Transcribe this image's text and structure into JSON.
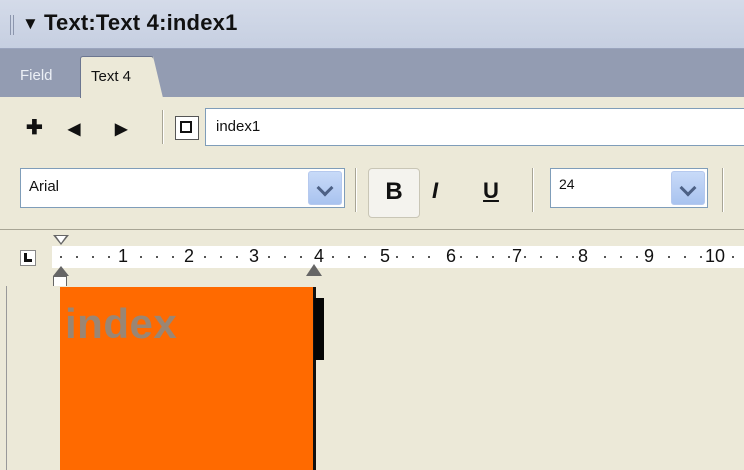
{
  "panel": {
    "title": "Text:Text 4:index1"
  },
  "tabs": [
    {
      "label": "Field"
    },
    {
      "label": "Text 4"
    }
  ],
  "toolbar": {
    "member_name": "index1"
  },
  "format": {
    "font": "Arial",
    "bold_label": "B",
    "italic_label": "I",
    "underline_label": "U",
    "size": "24"
  },
  "ruler": {
    "numbers": [
      "1",
      "2",
      "3",
      "4",
      "5",
      "6",
      "7",
      "8",
      "9",
      "10"
    ]
  },
  "stage": {
    "text": "index"
  },
  "colors": {
    "sprite_fill": "#ff6a00",
    "panel_bg": "#ece9d8",
    "tab_strip": "#939cb2"
  },
  "icons": [
    "gripper-icon",
    "expand-arrow-icon",
    "add-icon",
    "previous-icon",
    "next-icon",
    "dropdown-arrow-icon",
    "ruler-corner-icon"
  ]
}
